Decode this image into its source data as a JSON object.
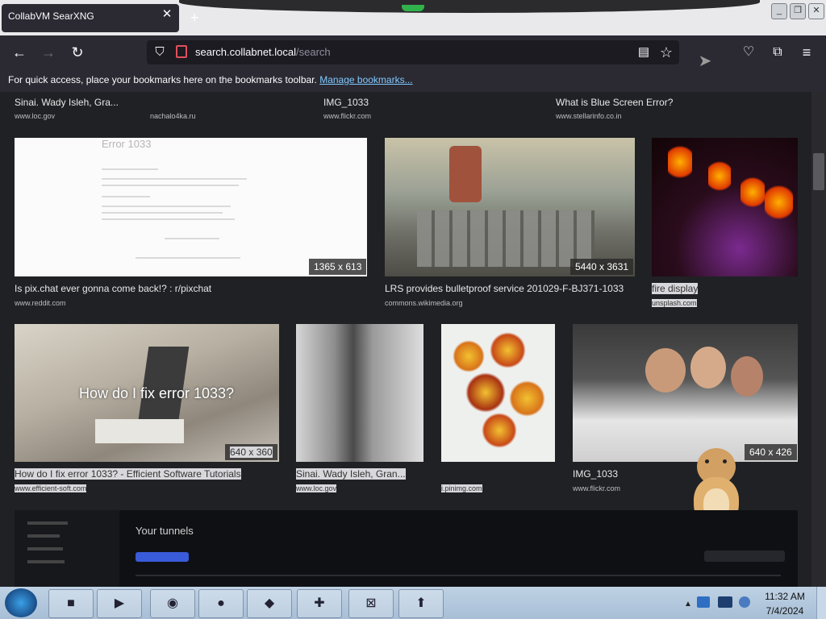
{
  "browser": {
    "tab_title": "CollabVM SearXNG",
    "url_domain": "search.collabnet.local",
    "url_path": "/search",
    "bookmarks_bar_text": "For quick access, place your bookmarks here on the bookmarks toolbar.",
    "bookmarks_link": "Manage bookmarks..."
  },
  "results_top": [
    {
      "caption": "Sinai. Wady Isleh, Gra...",
      "source": "www.loc.gov",
      "source2": "nachalo4ka.ru"
    },
    {
      "caption": "IMG_1033",
      "source": "www.flickr.com"
    },
    {
      "caption": "What is Blue Screen Error?",
      "source": "www.stellarinfo.co.in"
    }
  ],
  "results_row1": [
    {
      "caption": "Is pix.chat ever gonna come back!? : r/pixchat",
      "source": "www.reddit.com",
      "resolution": "1365 x 613",
      "image_text": "Error 1033"
    },
    {
      "caption": "LRS provides bulletproof service 201029-F-BJ371-1033",
      "source": "commons.wikimedia.org",
      "resolution": "5440 x 3631"
    },
    {
      "caption": "fire display",
      "source": "unsplash.com"
    }
  ],
  "results_row2": [
    {
      "caption": "How do I fix error 1033? - Efficient Software Tutorials",
      "source": "www.efficient-soft.com",
      "resolution": "640 x 360",
      "image_text": "How do I fix error 1033?"
    },
    {
      "caption": "Sinai. Wady Isleh, Gran...",
      "source": "www.loc.gov"
    },
    {
      "caption": "",
      "source": "i.pinimg.com"
    },
    {
      "caption": "IMG_1033",
      "source": "www.flickr.com",
      "resolution": "640 x 426"
    }
  ],
  "partial_image_text": "Your tunnels",
  "taskbar": {
    "time": "11:32 AM",
    "date": "7/4/2024"
  },
  "colors": {
    "tab_bg": "#2b2a33",
    "page_bg": "#202124",
    "link": "#80c9ff",
    "taskbar": "#a7bed6"
  }
}
